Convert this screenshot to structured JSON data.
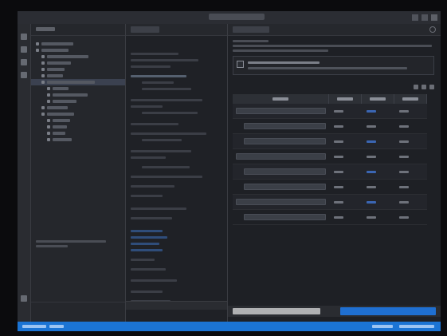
{
  "window": {
    "title": ""
  },
  "activity_bar": {
    "icons": [
      "explorer-icon",
      "search-icon",
      "source-control-icon",
      "debug-icon",
      "extensions-icon"
    ]
  },
  "tree": {
    "header": "",
    "rows": [
      {
        "label": "",
        "level": 0,
        "selected": false
      },
      {
        "label": "",
        "level": 0,
        "selected": false
      },
      {
        "label": "",
        "level": 1,
        "selected": false
      },
      {
        "label": "",
        "level": 1,
        "selected": false
      },
      {
        "label": "",
        "level": 1,
        "selected": false
      },
      {
        "label": "",
        "level": 1,
        "selected": false
      },
      {
        "label": "",
        "level": 1,
        "selected": true
      },
      {
        "label": "",
        "level": 2,
        "selected": false
      },
      {
        "label": "",
        "level": 2,
        "selected": false
      },
      {
        "label": "",
        "level": 2,
        "selected": false
      },
      {
        "label": "",
        "level": 1,
        "selected": false
      },
      {
        "label": "",
        "level": 1,
        "selected": false
      },
      {
        "label": "",
        "level": 2,
        "selected": false
      },
      {
        "label": "",
        "level": 2,
        "selected": false
      },
      {
        "label": "",
        "level": 2,
        "selected": false
      },
      {
        "label": "",
        "level": 2,
        "selected": false
      }
    ]
  },
  "editor": {
    "tab": ""
  },
  "properties": {
    "tab": "",
    "description": [
      "",
      "",
      ""
    ],
    "option": {
      "checked": false,
      "text": ""
    },
    "columns": [
      "",
      "",
      "",
      ""
    ],
    "rows": [
      {
        "name": "",
        "type": "",
        "v1": "",
        "v2": ""
      },
      {
        "name": "",
        "type": "",
        "v1": "",
        "v2": ""
      },
      {
        "name": "",
        "type": "",
        "v1": "",
        "v2": ""
      },
      {
        "name": "",
        "type": "",
        "v1": "",
        "v2": ""
      },
      {
        "name": "",
        "type": "",
        "v1": "",
        "v2": ""
      },
      {
        "name": "",
        "type": "",
        "v1": "",
        "v2": ""
      },
      {
        "name": "",
        "type": "",
        "v1": "",
        "v2": ""
      },
      {
        "name": "",
        "type": "",
        "v1": "",
        "v2": ""
      }
    ]
  },
  "colors": {
    "accent": "#1f6fd1",
    "status_bar": "#1b74d4",
    "selection": "#3b4150"
  }
}
